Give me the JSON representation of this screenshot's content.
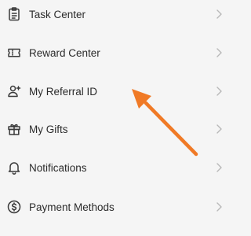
{
  "menu": {
    "items": [
      {
        "label": "Task Center",
        "icon": "clipboard-list-icon"
      },
      {
        "label": "Reward Center",
        "icon": "ticket-icon"
      },
      {
        "label": "My Referral ID",
        "icon": "user-plus-icon"
      },
      {
        "label": "My Gifts",
        "icon": "gift-icon"
      },
      {
        "label": "Notifications",
        "icon": "bell-icon"
      },
      {
        "label": "Payment Methods",
        "icon": "dollar-circle-icon"
      }
    ]
  },
  "colors": {
    "background": "#f5f5f5",
    "text": "#2b2b2b",
    "icon": "#3a3a3a",
    "chevron": "#b8b8b8",
    "arrow": "#f07a26"
  }
}
